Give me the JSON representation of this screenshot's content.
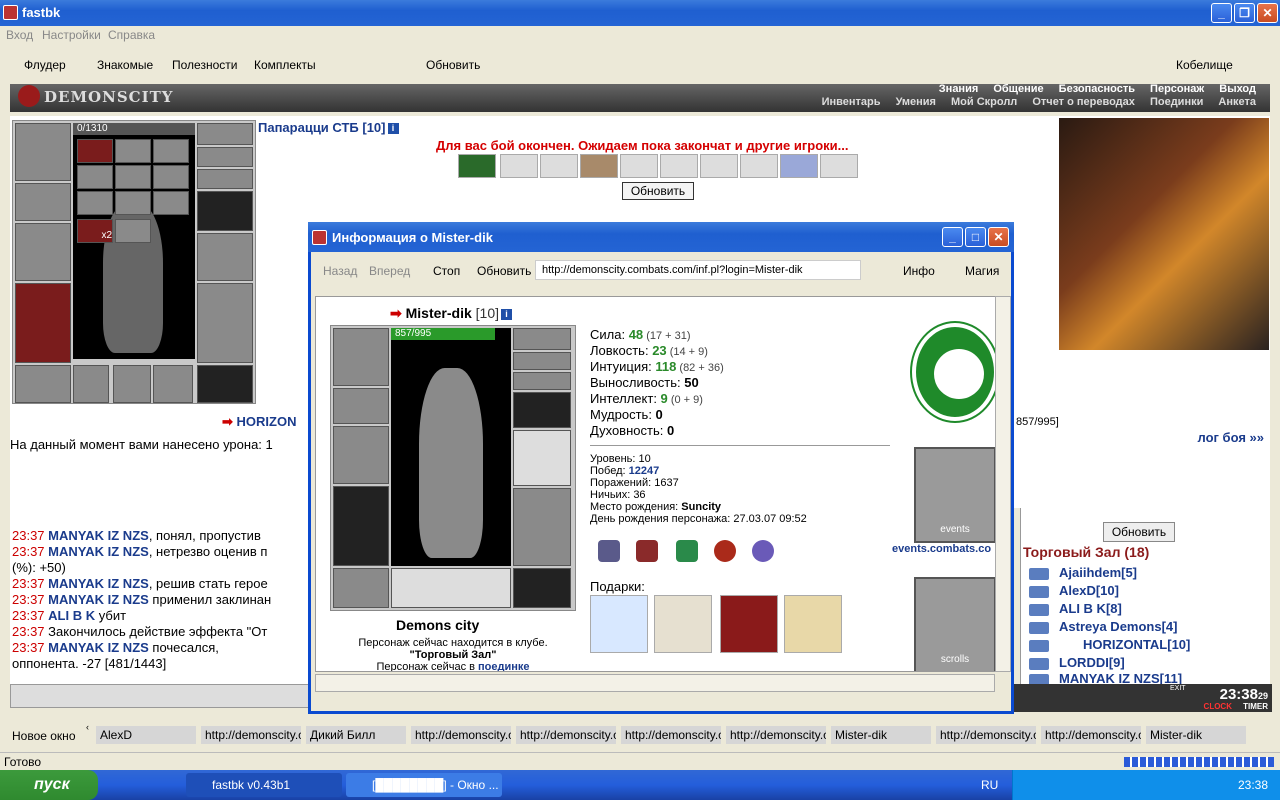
{
  "app": {
    "title": "fastbk"
  },
  "menu": [
    "Вход",
    "Настройки",
    "Справка"
  ],
  "toolbar": {
    "items": [
      "Флудер",
      "Знакомые",
      "Полезности",
      "Комплекты"
    ],
    "refresh": "Обновить",
    "location": "Кобелище"
  },
  "header": {
    "logo": "DEMONSCITY",
    "nav1": [
      "Знания",
      "Общение",
      "Безопасность",
      "Персонаж",
      "Выход"
    ],
    "nav2": [
      "Инвентарь",
      "Умения",
      "Мой Скролл",
      "Отчет о переводах",
      "Поединки",
      "Анкета"
    ]
  },
  "battle": {
    "hp": "0/1310",
    "paparazzi": "Папарацци СТБ [10]",
    "message": "Для вас бой окончен. Ожидаем пока закончат и другие игроки...",
    "refresh": "Обновить",
    "horizontal": "HORIZON",
    "damage": "На данный момент вами нанесено урона: 1",
    "opponent_hp": "857/995]",
    "log": "лог боя »»",
    "stack_label": "x2"
  },
  "chat": [
    {
      "time": "23:37",
      "name": "MANYAK IZ NZS",
      "text": ", понял, пропустив"
    },
    {
      "time": "23:37",
      "name": "MANYAK IZ NZS",
      "text": ", нетрезво оценив п"
    },
    {
      "time": "",
      "name": "",
      "text": "(%): +50)"
    },
    {
      "time": "23:37",
      "name": "MANYAK IZ NZS",
      "text": ", решив стать герое"
    },
    {
      "time": "23:37",
      "name": "MANYAK IZ NZS",
      "text": " применил заклинан"
    },
    {
      "time": "23:37",
      "name": "ALI B K",
      "text": " убит"
    },
    {
      "time": "23:37",
      "name": "",
      "text": "Закончилось действие эффекта \"От"
    },
    {
      "time": "23:37",
      "name": "MANYAK IZ NZS",
      "text": " почесался,"
    },
    {
      "time": "",
      "name": "",
      "text": "оппонента. -27 [481/1443]"
    }
  ],
  "hall": {
    "refresh": "Обновить",
    "title": "Торговый Зал (18)",
    "users": [
      "Ajaiihdem[5]",
      "AlexD[10]",
      "ALI B K[8]",
      "Astreya Demons[4]",
      "HORIZONTAL[10]",
      "LORDDI[9]",
      "MANYAK IZ NZS[11]"
    ]
  },
  "clock": {
    "time": "23:38",
    "sec": "29",
    "clock_label": "CLOCK",
    "timer_label": "TIMER",
    "exit_label": "EXIT"
  },
  "tabs": {
    "new_window": "Новое окно",
    "items": [
      "AlexD",
      "http://demonscity.co",
      "Дикий Билл",
      "http://demonscity.co",
      "http://demonscity.co",
      "http://demonscity.co",
      "http://demonscity.co",
      "Mister-dik",
      "http://demonscity.co",
      "http://demonscity.co",
      "Mister-dik"
    ]
  },
  "status": "Готово",
  "taskbar": {
    "start": "пуск",
    "tasks": [
      "fastbk v0.43b1",
      "[████████] - Окно ..."
    ],
    "lang": "RU",
    "time": "23:38"
  },
  "dialog": {
    "title": "Информация о Mister-dik",
    "nav": {
      "back": "Назад",
      "forward": "Вперед",
      "stop": "Стоп",
      "refresh": "Обновить",
      "info": "Инфо",
      "magic": "Магия"
    },
    "url": "http://demonscity.combats.com/inf.pl?login=Mister-dik",
    "name": "Mister-dik",
    "level": "[10]",
    "hp": "857/995",
    "stats": [
      {
        "label": "Сила: ",
        "value": "48",
        "extra": " (17 + 31)"
      },
      {
        "label": "Ловкость: ",
        "value": "23",
        "extra": " (14 + 9)"
      },
      {
        "label": "Интуиция: ",
        "value": "118",
        "extra": " (82 + 36)"
      },
      {
        "label": "Выносливость: ",
        "value": "50",
        "extra": ""
      },
      {
        "label": "Интеллект: ",
        "value": "9",
        "extra": " (0 + 9)"
      },
      {
        "label": "Мудрость: ",
        "value": "0",
        "extra": ""
      },
      {
        "label": "Духовность: ",
        "value": "0",
        "extra": ""
      }
    ],
    "info": [
      {
        "label": "Уровень: ",
        "value": "10"
      },
      {
        "label": "Побед: ",
        "value": "12247"
      },
      {
        "label": "Поражений: ",
        "value": "1637"
      },
      {
        "label": "Ничьих: ",
        "value": "36"
      },
      {
        "label": "Место рождения: ",
        "value": "Suncity"
      },
      {
        "label": "День рождения персонажа: ",
        "value": "27.03.07 09:52"
      }
    ],
    "gifts_label": "Подарки:",
    "events_link": "events.combats.co",
    "events_label": "events",
    "scrolls_label": "scrolls",
    "city": "Demons city",
    "club_line1": "Персонаж сейчас находится в клубе.",
    "club_line2": "\"Торговый Зал\"",
    "duel_prefix": "Персонаж сейчас в ",
    "duel_link": "поединке"
  }
}
